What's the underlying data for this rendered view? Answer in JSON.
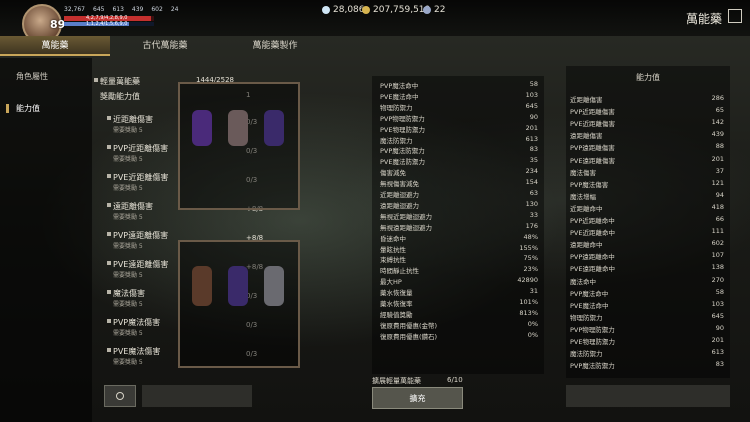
{
  "player": {
    "level": "89",
    "stats": [
      "32,767",
      "645",
      "613",
      "439",
      "602",
      "24"
    ],
    "hp_text": "4,2,7,9/4,2,8,9,0",
    "mp_text": "1,1,2,4/1,5,6,9,0",
    "hp_fraction": 0.97,
    "mp_fraction": 0.72
  },
  "currency": {
    "diamond": "28,086",
    "gold": "207,759,510",
    "other": "22"
  },
  "header": {
    "title": "萬能藥"
  },
  "tabs": [
    {
      "label": "萬能藥"
    },
    {
      "label": "古代萬能藥"
    },
    {
      "label": "萬能藥製作"
    }
  ],
  "sidenav": {
    "items": [
      {
        "label": "角色屬性"
      },
      {
        "label": "能力值"
      }
    ]
  },
  "potion": {
    "light_label": "輕量萬能藥",
    "light_value": "1444/2528",
    "bonus_label": "獎勵能力值",
    "bonus_value": "1",
    "items": [
      {
        "name": "近距離傷害",
        "req": "需要獎勵 5",
        "val": "0/3"
      },
      {
        "name": "PVP近距離傷害",
        "req": "需要獎勵 5",
        "val": "0/3"
      },
      {
        "name": "PVE近距離傷害",
        "req": "需要獎勵 5",
        "val": "0/3"
      },
      {
        "name": "遠距離傷害",
        "req": "需要獎勵 5",
        "val": "+8/8"
      },
      {
        "name": "PVP遠距離傷害",
        "req": "需要獎勵 5",
        "val": "+8/8"
      },
      {
        "name": "PVE遠距離傷害",
        "req": "需要獎勵 5",
        "val": "+8/8"
      },
      {
        "name": "魔法傷害",
        "req": "需要獎勵 5",
        "val": "0/3"
      },
      {
        "name": "PVP魔法傷害",
        "req": "需要獎勵 5",
        "val": "0/3"
      },
      {
        "name": "PVE魔法傷害",
        "req": "需要獎勵 5",
        "val": "0/3"
      }
    ]
  },
  "stats_panel": [
    {
      "k": "PVP魔法命中",
      "v": "58"
    },
    {
      "k": "PVE魔法命中",
      "v": "103"
    },
    {
      "k": "物理防禦力",
      "v": "645"
    },
    {
      "k": "PVP物理防禦力",
      "v": "90"
    },
    {
      "k": "PVE物理防禦力",
      "v": "201"
    },
    {
      "k": "魔法防禦力",
      "v": "613"
    },
    {
      "k": "PVP魔法防禦力",
      "v": "83"
    },
    {
      "k": "PVE魔法防禦力",
      "v": "35"
    },
    {
      "k": "傷害減免",
      "v": "234"
    },
    {
      "k": "無視傷害減免",
      "v": "154"
    },
    {
      "k": "近距離迴避力",
      "v": "63"
    },
    {
      "k": "遠距離迴避力",
      "v": "130"
    },
    {
      "k": "無視近距離迴避力",
      "v": "33"
    },
    {
      "k": "無視遠距離迴避力",
      "v": "176"
    },
    {
      "k": "昏迷命中",
      "v": "48%"
    },
    {
      "k": "暈眩抗性",
      "v": "155%"
    },
    {
      "k": "束縛抗性",
      "v": "75%"
    },
    {
      "k": "時間靜止抗性",
      "v": "23%"
    },
    {
      "k": "最大HP",
      "v": "42890"
    },
    {
      "k": "藥水恢復量",
      "v": "31"
    },
    {
      "k": "藥水恢復率",
      "v": "101%"
    },
    {
      "k": "經驗值獎勵",
      "v": "813%"
    },
    {
      "k": "復原費用優惠(金幣)",
      "v": "0%"
    },
    {
      "k": "復原費用優惠(鑽石)",
      "v": "0%"
    }
  ],
  "ability_panel": {
    "title": "能力值",
    "rows": [
      {
        "k": "近距離傷害",
        "v": "286"
      },
      {
        "k": "PVP近距離傷害",
        "v": "65"
      },
      {
        "k": "PVE近距離傷害",
        "v": "142"
      },
      {
        "k": "遠距離傷害",
        "v": "439"
      },
      {
        "k": "PVP遠距離傷害",
        "v": "88"
      },
      {
        "k": "PVE遠距離傷害",
        "v": "201"
      },
      {
        "k": "魔法傷害",
        "v": "37"
      },
      {
        "k": "PVP魔法傷害",
        "v": "121"
      },
      {
        "k": "魔法增幅",
        "v": "94"
      },
      {
        "k": "近距離命中",
        "v": "418"
      },
      {
        "k": "PVP近距離命中",
        "v": "66"
      },
      {
        "k": "PVE近距離命中",
        "v": "111"
      },
      {
        "k": "遠距離命中",
        "v": "602"
      },
      {
        "k": "PVP遠距離命中",
        "v": "107"
      },
      {
        "k": "PVE遠距離命中",
        "v": "138"
      },
      {
        "k": "魔法命中",
        "v": "270"
      },
      {
        "k": "PVP魔法命中",
        "v": "58"
      },
      {
        "k": "PVE魔法命中",
        "v": "103"
      },
      {
        "k": "物理防禦力",
        "v": "645"
      },
      {
        "k": "PVP物理防禦力",
        "v": "90"
      },
      {
        "k": "PVE物理防禦力",
        "v": "201"
      },
      {
        "k": "魔法防禦力",
        "v": "613"
      },
      {
        "k": "PVP魔法防禦力",
        "v": "83"
      }
    ]
  },
  "extension": {
    "label": "擴展輕量萬能藥",
    "value": "6/10"
  },
  "buttons": {
    "fill": "擴充",
    "disabled_left": "",
    "confirm": ""
  }
}
